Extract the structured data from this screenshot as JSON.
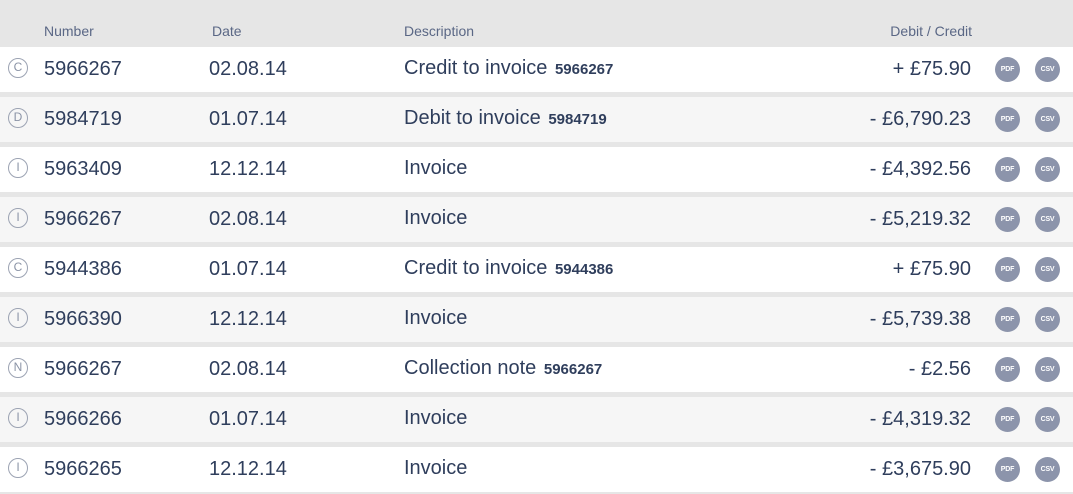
{
  "header": {
    "number": "Number",
    "date": "Date",
    "description": "Description",
    "amount": "Debit / Credit"
  },
  "buttons": {
    "pdf": "PDF",
    "csv": "CSV"
  },
  "rows": [
    {
      "type": "C",
      "number": "5966267",
      "date": "02.08.14",
      "description": "Credit to invoice",
      "ref": "5966267",
      "amount": "+ £75.90"
    },
    {
      "type": "D",
      "number": "5984719",
      "date": "01.07.14",
      "description": "Debit to invoice",
      "ref": "5984719",
      "amount": "- £6,790.23"
    },
    {
      "type": "I",
      "number": "5963409",
      "date": "12.12.14",
      "description": "Invoice",
      "ref": "",
      "amount": "- £4,392.56"
    },
    {
      "type": "I",
      "number": "5966267",
      "date": "02.08.14",
      "description": "Invoice",
      "ref": "",
      "amount": "- £5,219.32"
    },
    {
      "type": "C",
      "number": "5944386",
      "date": "01.07.14",
      "description": "Credit to invoice",
      "ref": "5944386",
      "amount": "+ £75.90"
    },
    {
      "type": "I",
      "number": "5966390",
      "date": "12.12.14",
      "description": "Invoice",
      "ref": "",
      "amount": "- £5,739.38"
    },
    {
      "type": "N",
      "number": "5966267",
      "date": "02.08.14",
      "description": "Collection note",
      "ref": "5966267",
      "amount": "- £2.56"
    },
    {
      "type": "I",
      "number": "5966266",
      "date": "01.07.14",
      "description": "Invoice",
      "ref": "",
      "amount": "- £4,319.32"
    },
    {
      "type": "I",
      "number": "5966265",
      "date": "12.12.14",
      "description": "Invoice",
      "ref": "",
      "amount": "- £3,675.90"
    }
  ]
}
